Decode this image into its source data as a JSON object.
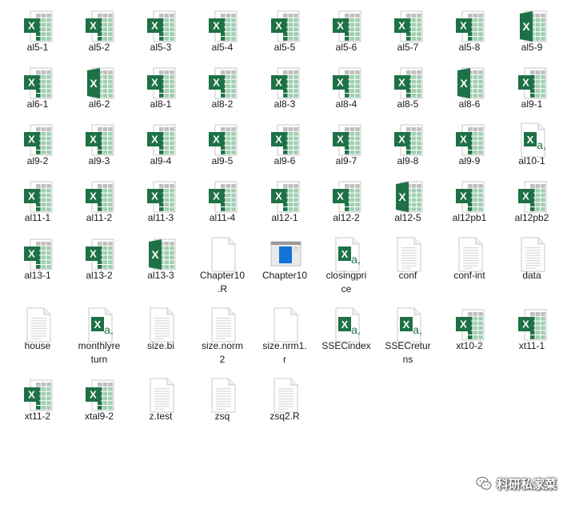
{
  "colors": {
    "excel_green": "#1e7145",
    "excel_grid": "#9fcfb0",
    "excel_grid_dark": "#217346",
    "doc_gray": "#d9d9d9"
  },
  "files": [
    {
      "name": "al5-1",
      "icon": "excel-xlsx-icon"
    },
    {
      "name": "al5-2",
      "icon": "excel-xlsx-icon"
    },
    {
      "name": "al5-3",
      "icon": "excel-xlsx-icon"
    },
    {
      "name": "al5-4",
      "icon": "excel-xlsx-icon"
    },
    {
      "name": "al5-5",
      "icon": "excel-xlsx-icon"
    },
    {
      "name": "al5-6",
      "icon": "excel-xlsx-icon"
    },
    {
      "name": "al5-7",
      "icon": "excel-xlsx-icon"
    },
    {
      "name": "al5-8",
      "icon": "excel-xlsx-icon"
    },
    {
      "name": "al5-9",
      "icon": "excel-xls-icon"
    },
    {
      "name": "al6-1",
      "icon": "excel-xlsx-icon"
    },
    {
      "name": "al6-2",
      "icon": "excel-xls-icon"
    },
    {
      "name": "al8-1",
      "icon": "excel-xlsx-icon"
    },
    {
      "name": "al8-2",
      "icon": "excel-xlsx-icon"
    },
    {
      "name": "al8-3",
      "icon": "excel-xlsx-icon"
    },
    {
      "name": "al8-4",
      "icon": "excel-xlsx-icon"
    },
    {
      "name": "al8-5",
      "icon": "excel-xlsx-icon"
    },
    {
      "name": "al8-6",
      "icon": "excel-xls-icon"
    },
    {
      "name": "al9-1",
      "icon": "excel-xlsx-icon"
    },
    {
      "name": "al9-2",
      "icon": "excel-xlsx-icon"
    },
    {
      "name": "al9-3",
      "icon": "excel-xlsx-icon"
    },
    {
      "name": "al9-4",
      "icon": "excel-xlsx-icon"
    },
    {
      "name": "al9-5",
      "icon": "excel-xlsx-icon"
    },
    {
      "name": "al9-6",
      "icon": "excel-xlsx-icon"
    },
    {
      "name": "al9-7",
      "icon": "excel-xlsx-icon"
    },
    {
      "name": "al9-8",
      "icon": "excel-xlsx-icon"
    },
    {
      "name": "al9-9",
      "icon": "excel-xlsx-icon"
    },
    {
      "name": "al10-1",
      "icon": "excel-csv-icon"
    },
    {
      "name": "al11-1",
      "icon": "excel-xlsx-icon"
    },
    {
      "name": "al11-2",
      "icon": "excel-xlsx-icon"
    },
    {
      "name": "al11-3",
      "icon": "excel-xlsx-icon"
    },
    {
      "name": "al11-4",
      "icon": "excel-xlsx-icon"
    },
    {
      "name": "al12-1",
      "icon": "excel-xlsx-icon"
    },
    {
      "name": "al12-2",
      "icon": "excel-xlsx-icon"
    },
    {
      "name": "al12-5",
      "icon": "excel-xls-icon"
    },
    {
      "name": "al12pb1",
      "icon": "excel-xlsx-icon"
    },
    {
      "name": "al12pb2",
      "icon": "excel-xlsx-icon"
    },
    {
      "name": "al13-1",
      "icon": "excel-xlsx-icon"
    },
    {
      "name": "al13-2",
      "icon": "excel-xlsx-icon"
    },
    {
      "name": "al13-3",
      "icon": "excel-xls-icon"
    },
    {
      "name": "Chapter10\n.R",
      "icon": "blank-file-icon"
    },
    {
      "name": "Chapter10",
      "icon": "window-file-icon"
    },
    {
      "name": "closingpri\nce",
      "icon": "excel-csv-icon"
    },
    {
      "name": "conf",
      "icon": "text-file-icon"
    },
    {
      "name": "conf-int",
      "icon": "text-file-icon"
    },
    {
      "name": "data",
      "icon": "text-file-icon"
    },
    {
      "name": "house",
      "icon": "text-file-icon"
    },
    {
      "name": "monthlyre\nturn",
      "icon": "excel-csv-icon"
    },
    {
      "name": "size.bi",
      "icon": "text-file-icon"
    },
    {
      "name": "size.norm\n2",
      "icon": "text-file-icon"
    },
    {
      "name": "size.nrm1.\nr",
      "icon": "blank-file-icon"
    },
    {
      "name": "SSECindex",
      "icon": "excel-csv-icon"
    },
    {
      "name": "SSECretur\nns",
      "icon": "excel-csv-icon"
    },
    {
      "name": "xt10-2",
      "icon": "excel-xlsx-icon"
    },
    {
      "name": "xt11-1",
      "icon": "excel-xlsx-icon"
    },
    {
      "name": "xt11-2",
      "icon": "excel-xlsx-icon"
    },
    {
      "name": "xtal9-2",
      "icon": "excel-xlsx-icon"
    },
    {
      "name": "z.test",
      "icon": "text-file-icon"
    },
    {
      "name": "zsq",
      "icon": "text-file-icon"
    },
    {
      "name": "zsq2.R",
      "icon": "text-file-icon"
    }
  ],
  "watermark": {
    "text": "科研私家菜",
    "icon": "wechat-icon"
  }
}
